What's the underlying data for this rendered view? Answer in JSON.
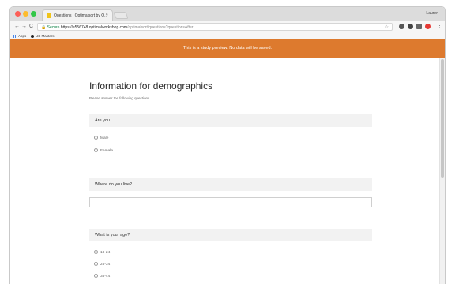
{
  "browser": {
    "tab_title": "Questions | Optimalsort by O...",
    "tab_close": "×",
    "profile": "Lauren",
    "nav": {
      "back": "←",
      "forward": "→",
      "reload": "C"
    },
    "secure_label": "Secure",
    "url_host": "https://e556748.optimalworkshop.com",
    "url_path": "/optimalsort/questions?questionsAfter",
    "star": "☆",
    "menu": "⋮"
  },
  "bookmarks": [
    {
      "label": "Apps"
    },
    {
      "label": "UX Masters"
    }
  ],
  "banner": {
    "text": "This is a study preview. No data will be saved."
  },
  "page": {
    "title": "Information for demographics",
    "subtitle": "Please answer the following questions"
  },
  "questions": [
    {
      "label": "Are you...",
      "options": [
        "Male",
        "Female"
      ]
    },
    {
      "label": "Where do you live?",
      "input_value": ""
    },
    {
      "label": "What is your age?",
      "options": [
        "18-24",
        "25-34",
        "35-44",
        "45-54"
      ]
    }
  ]
}
